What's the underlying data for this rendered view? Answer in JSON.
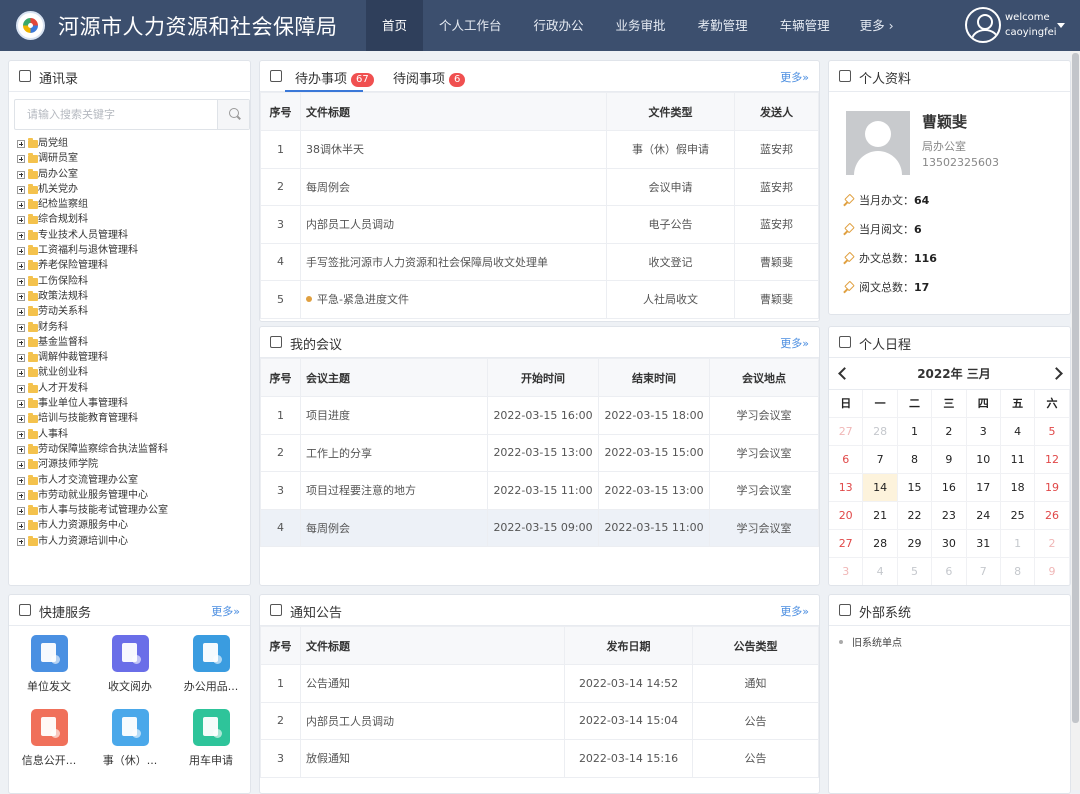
{
  "header": {
    "title": "河源市人力资源和社会保障局",
    "nav": [
      "首页",
      "个人工作台",
      "行政办公",
      "业务审批",
      "考勤管理",
      "车辆管理"
    ],
    "nav_more": "更多 ›",
    "welcome": "welcome",
    "username": "caoyingfei"
  },
  "contacts": {
    "title": "通讯录",
    "search_placeholder": "请输入搜索关键字",
    "tree": [
      "局党组",
      "调研员室",
      "局办公室",
      "机关党办",
      "纪检监察组",
      "综合规划科",
      "专业技术人员管理科",
      "工资福利与退休管理科",
      "养老保险管理科",
      "工伤保险科",
      "政策法规科",
      "劳动关系科",
      "财务科",
      "基金监督科",
      "调解仲裁管理科",
      "就业创业科",
      "人才开发科",
      "事业单位人事管理科",
      "培训与技能教育管理科",
      "人事科",
      "劳动保障监察综合执法监督科",
      "河源技师学院",
      "市人才交流管理办公室",
      "市劳动就业服务管理中心",
      "市人事与技能考试管理办公室",
      "市人力资源服务中心",
      "市人力资源培训中心"
    ]
  },
  "todo": {
    "tab_pending": "待办事项",
    "pending_count": "67",
    "tab_toread": "待阅事项",
    "toread_count": "6",
    "more": "更多»",
    "columns": [
      "序号",
      "文件标题",
      "文件类型",
      "发送人"
    ],
    "rows": [
      {
        "no": "1",
        "title": "38调休半天",
        "type": "事（休）假申请",
        "sender": "蓝安邦",
        "urgent": false
      },
      {
        "no": "2",
        "title": "每周例会",
        "type": "会议申请",
        "sender": "蓝安邦",
        "urgent": false
      },
      {
        "no": "3",
        "title": "内部员工人员调动",
        "type": "电子公告",
        "sender": "蓝安邦",
        "urgent": false
      },
      {
        "no": "4",
        "title": "手写签批河源市人力资源和社会保障局收文处理单",
        "type": "收文登记",
        "sender": "曹颖斐",
        "urgent": false
      },
      {
        "no": "5",
        "title": "平急-紧急进度文件",
        "type": "人社局收文",
        "sender": "曹颖斐",
        "urgent": true
      }
    ]
  },
  "meetings": {
    "title": "我的会议",
    "more": "更多»",
    "columns": [
      "序号",
      "会议主题",
      "开始时间",
      "结束时间",
      "会议地点"
    ],
    "rows": [
      {
        "no": "1",
        "topic": "项目进度",
        "start": "2022-03-15 16:00",
        "end": "2022-03-15 18:00",
        "place": "学习会议室"
      },
      {
        "no": "2",
        "topic": "工作上的分享",
        "start": "2022-03-15 13:00",
        "end": "2022-03-15 15:00",
        "place": "学习会议室"
      },
      {
        "no": "3",
        "topic": "项目过程要注意的地方",
        "start": "2022-03-15 11:00",
        "end": "2022-03-15 13:00",
        "place": "学习会议室"
      },
      {
        "no": "4",
        "topic": "每周例会",
        "start": "2022-03-15 09:00",
        "end": "2022-03-15 11:00",
        "place": "学习会议室"
      }
    ]
  },
  "notices": {
    "title": "通知公告",
    "more": "更多»",
    "columns": [
      "序号",
      "文件标题",
      "发布日期",
      "公告类型"
    ],
    "rows": [
      {
        "no": "1",
        "title": "公告通知",
        "date": "2022-03-14 14:52",
        "type": "通知"
      },
      {
        "no": "2",
        "title": "内部员工人员调动",
        "date": "2022-03-14 15:04",
        "type": "公告"
      },
      {
        "no": "3",
        "title": "放假通知",
        "date": "2022-03-14 15:16",
        "type": "公告"
      }
    ]
  },
  "quick": {
    "title": "快捷服务",
    "more": "更多»",
    "items": [
      {
        "label": "单位发文",
        "color": "#4a90e2",
        "icon": "document-send-icon"
      },
      {
        "label": "收文阅办",
        "color": "#6a6ee8",
        "icon": "document-receive-icon"
      },
      {
        "label": "办公用品...",
        "color": "#3a9ce0",
        "icon": "notebook-icon"
      },
      {
        "label": "信息公开...",
        "color": "#f0705a",
        "icon": "document-edit-icon"
      },
      {
        "label": "事（休）...",
        "color": "#4aa8ea",
        "icon": "person-leave-icon"
      },
      {
        "label": "用车申请",
        "color": "#2ec49a",
        "icon": "car-icon"
      }
    ]
  },
  "profile": {
    "title": "个人资料",
    "name": "曹颖斐",
    "dept": "局办公室",
    "phone": "13502325603",
    "stats": [
      {
        "label": "当月办文：",
        "value": "64"
      },
      {
        "label": "当月阅文：",
        "value": "6"
      },
      {
        "label": "办文总数：",
        "value": "116"
      },
      {
        "label": "阅文总数：",
        "value": "17"
      }
    ]
  },
  "schedule": {
    "title": "个人日程",
    "month_label": "2022年 三月",
    "weekdays": [
      "日",
      "一",
      "二",
      "三",
      "四",
      "五",
      "六"
    ],
    "weeks": [
      [
        {
          "d": "27",
          "dim": true
        },
        {
          "d": "28",
          "dim": true
        },
        {
          "d": "1"
        },
        {
          "d": "2"
        },
        {
          "d": "3"
        },
        {
          "d": "4"
        },
        {
          "d": "5"
        }
      ],
      [
        {
          "d": "6"
        },
        {
          "d": "7"
        },
        {
          "d": "8"
        },
        {
          "d": "9"
        },
        {
          "d": "10"
        },
        {
          "d": "11"
        },
        {
          "d": "12"
        }
      ],
      [
        {
          "d": "13"
        },
        {
          "d": "14",
          "today": true
        },
        {
          "d": "15"
        },
        {
          "d": "16"
        },
        {
          "d": "17"
        },
        {
          "d": "18"
        },
        {
          "d": "19"
        }
      ],
      [
        {
          "d": "20"
        },
        {
          "d": "21"
        },
        {
          "d": "22"
        },
        {
          "d": "23"
        },
        {
          "d": "24"
        },
        {
          "d": "25"
        },
        {
          "d": "26"
        }
      ],
      [
        {
          "d": "27"
        },
        {
          "d": "28"
        },
        {
          "d": "29"
        },
        {
          "d": "30"
        },
        {
          "d": "31"
        },
        {
          "d": "1",
          "dim": true
        },
        {
          "d": "2",
          "dim": true
        }
      ],
      [
        {
          "d": "3",
          "dim": true
        },
        {
          "d": "4",
          "dim": true
        },
        {
          "d": "5",
          "dim": true
        },
        {
          "d": "6",
          "dim": true
        },
        {
          "d": "7",
          "dim": true
        },
        {
          "d": "8",
          "dim": true
        },
        {
          "d": "9",
          "dim": true
        }
      ]
    ]
  },
  "external": {
    "title": "外部系统",
    "items": [
      "旧系统单点"
    ]
  }
}
